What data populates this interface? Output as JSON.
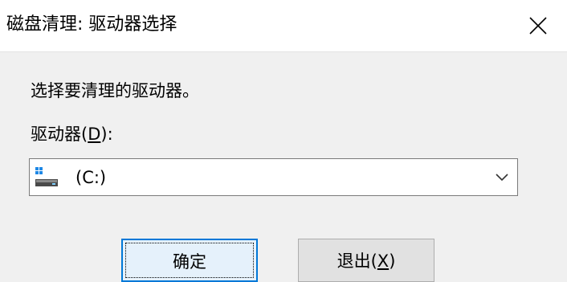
{
  "window": {
    "title": "磁盘清理: 驱动器选择",
    "close_icon": "close-icon"
  },
  "dialog": {
    "instruction": "选择要清理的驱动器。",
    "drive_label_prefix": "驱动器(",
    "drive_label_mnemonic": "D",
    "drive_label_suffix": "):",
    "selected_drive": "(C:)",
    "drive_icon": "hard-drive-icon",
    "dropdown_icon": "chevron-down-icon"
  },
  "buttons": {
    "ok_label": "确定",
    "exit_prefix": "退出(",
    "exit_mnemonic": "X",
    "exit_suffix": ")"
  },
  "colors": {
    "accent": "#0078d7",
    "window_bg": "#f0f0f0",
    "titlebar_bg": "#ffffff"
  }
}
